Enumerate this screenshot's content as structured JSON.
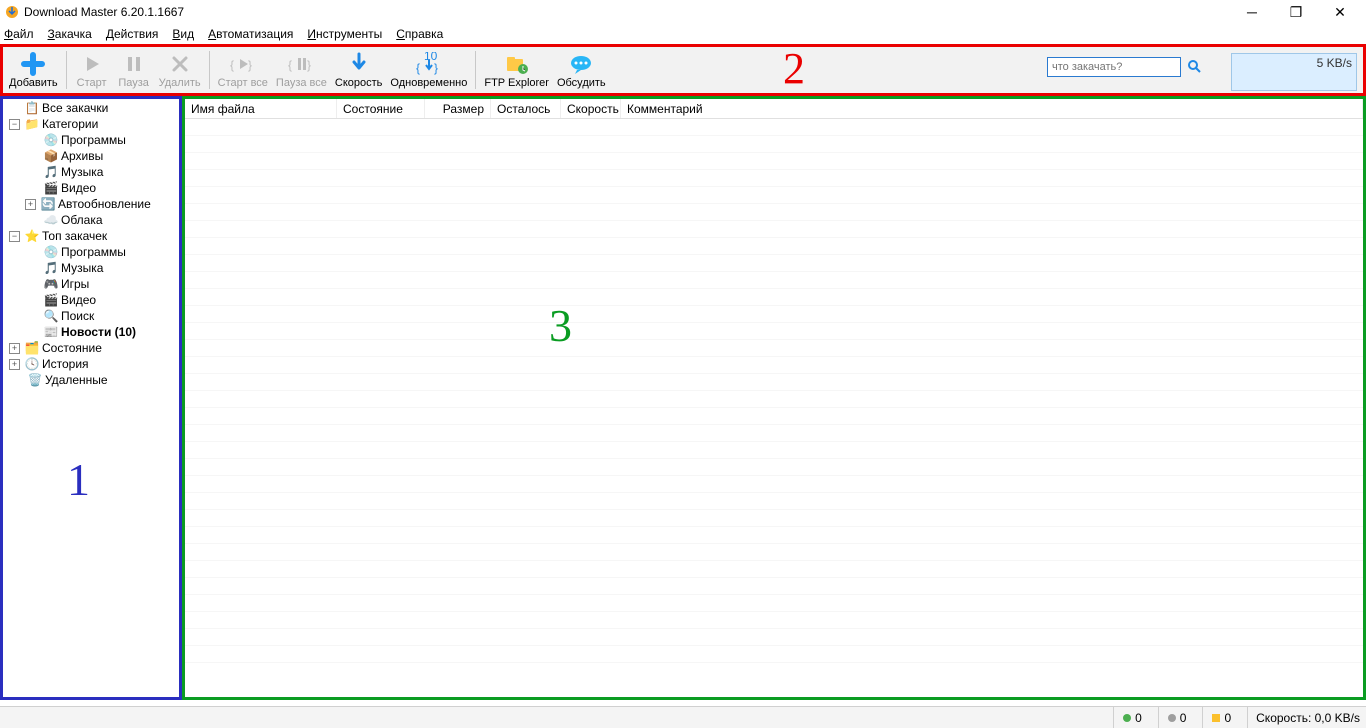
{
  "title": "Download Master 6.20.1.1667",
  "menu": [
    "Файл",
    "Закачка",
    "Действия",
    "Вид",
    "Автоматизация",
    "Инструменты",
    "Справка"
  ],
  "toolbar": {
    "add": "Добавить",
    "start": "Старт",
    "pause": "Пауза",
    "delete": "Удалить",
    "start_all": "Старт все",
    "pause_all": "Пауза все",
    "speed": "Скорость",
    "concurrent": "Одновременно",
    "concurrent_badge": "10",
    "ftp": "FTP Explorer",
    "discuss": "Обсудить",
    "search_placeholder": "что закачать?",
    "speed_display": "5 KB/s"
  },
  "annotations": {
    "a1": "1",
    "a2": "2",
    "a3": "3"
  },
  "tree": {
    "all": "Все закачки",
    "categories": "Категории",
    "cat_items": [
      "Программы",
      "Архивы",
      "Музыка",
      "Видео",
      "Автообновление",
      "Облака"
    ],
    "top": "Топ закачек",
    "top_items": [
      "Программы",
      "Музыка",
      "Игры",
      "Видео",
      "Поиск",
      "Новости (10)"
    ],
    "status": "Состояние",
    "history": "История",
    "deleted": "Удаленные"
  },
  "columns": {
    "file": "Имя файла",
    "state": "Состояние",
    "size": "Размер",
    "remain": "Осталось",
    "speed": "Скорость",
    "comment": "Комментарий"
  },
  "statusbar": {
    "g": "0",
    "d": "0",
    "y": "0",
    "speed_label": "Скорость: 0,0 KB/s"
  }
}
